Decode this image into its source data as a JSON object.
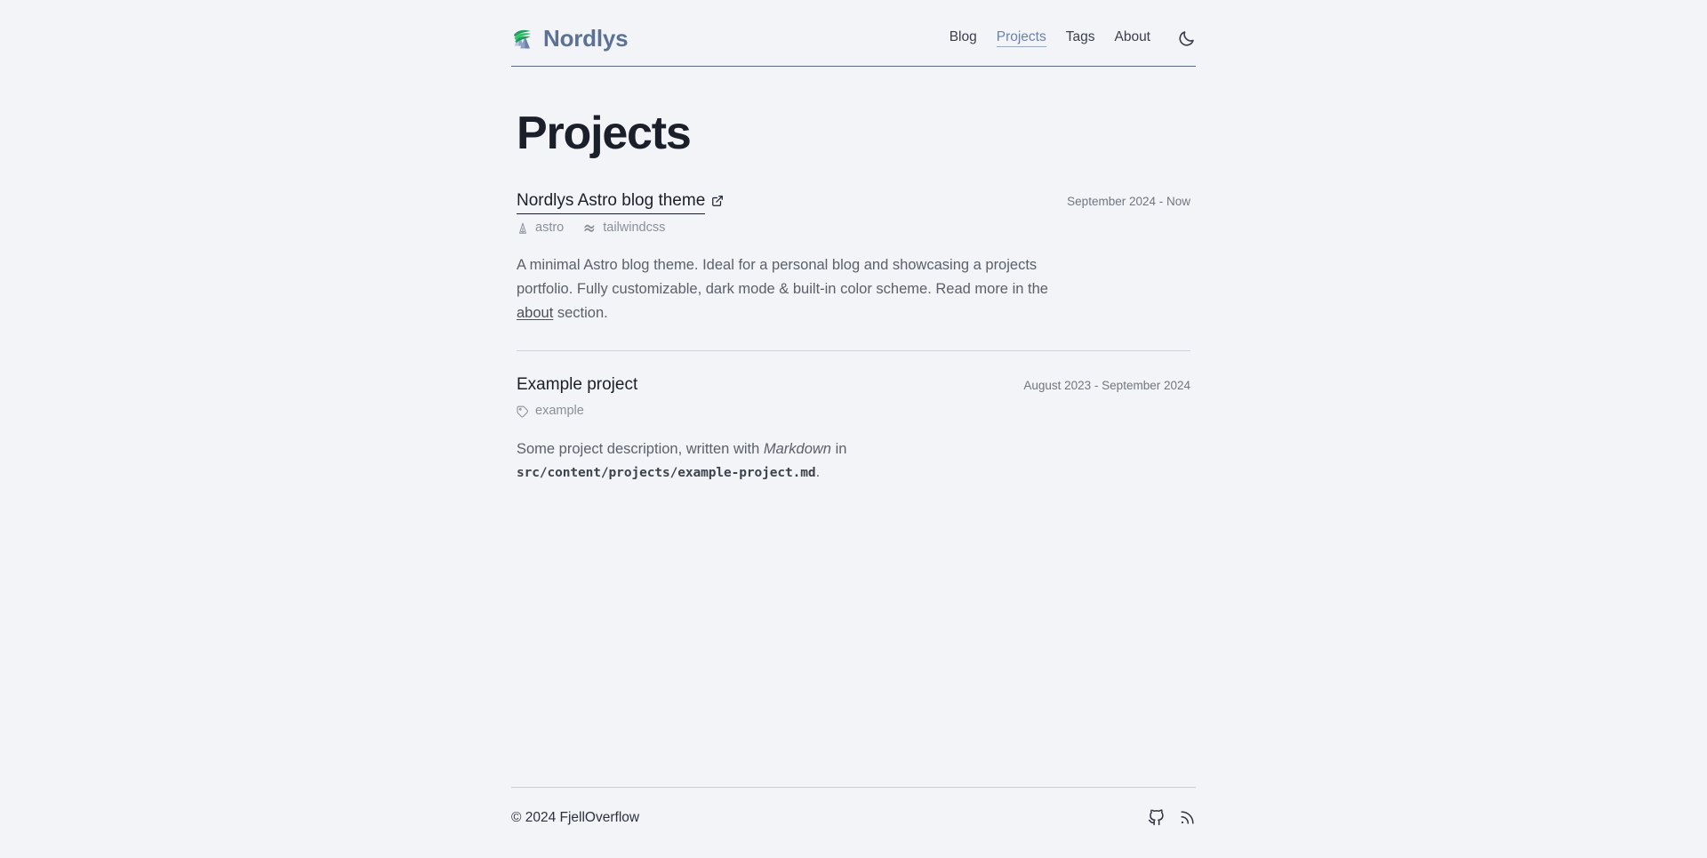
{
  "site": {
    "brand_name": "Nordlys",
    "logo_icon": "aurora-mountain-logo"
  },
  "nav": {
    "items": [
      {
        "label": "Blog",
        "active": false,
        "icon": ""
      },
      {
        "label": "Projects",
        "active": true,
        "icon": ""
      },
      {
        "label": "Tags",
        "active": false,
        "icon": ""
      },
      {
        "label": "About",
        "active": false,
        "icon": ""
      }
    ],
    "theme_toggle_icon": "moon-icon"
  },
  "page": {
    "title": "Projects"
  },
  "projects": [
    {
      "title": "Nordlys Astro blog theme",
      "is_link": true,
      "external_icon": "external-link-icon",
      "date": "September 2024 - Now",
      "tags": [
        {
          "label": "astro",
          "icon": "astro-icon"
        },
        {
          "label": "tailwindcss",
          "icon": "tailwindcss-icon"
        }
      ],
      "description_parts": [
        {
          "type": "text",
          "text": "A minimal Astro blog theme. Ideal for a personal blog and showcasing a projects portfolio. Fully customizable, dark mode & built-in color scheme. Read more in the "
        },
        {
          "type": "link",
          "text": "about"
        },
        {
          "type": "text",
          "text": " section."
        }
      ]
    },
    {
      "title": "Example project",
      "is_link": false,
      "external_icon": "",
      "date": "August 2023 - September 2024",
      "tags": [
        {
          "label": "example",
          "icon": "tag-icon"
        }
      ],
      "description_parts": [
        {
          "type": "text",
          "text": "Some project description, written with "
        },
        {
          "type": "em",
          "text": "Markdown"
        },
        {
          "type": "text",
          "text": " in "
        },
        {
          "type": "code",
          "text": "src/content/projects/example-project.md"
        },
        {
          "type": "text",
          "text": "."
        }
      ]
    }
  ],
  "footer": {
    "copyright": "© 2024 FjellOverflow",
    "social": [
      {
        "name": "github",
        "icon": "github-icon"
      },
      {
        "name": "rss",
        "icon": "rss-icon"
      }
    ]
  },
  "colors": {
    "background": "#f2f4f8",
    "brand": "#5b7296",
    "heading": "#1b1f2a",
    "muted": "#8a8f99",
    "body_text": "#5b6069",
    "rule": "#ccd0da",
    "header_rule": "#5c6a86"
  }
}
